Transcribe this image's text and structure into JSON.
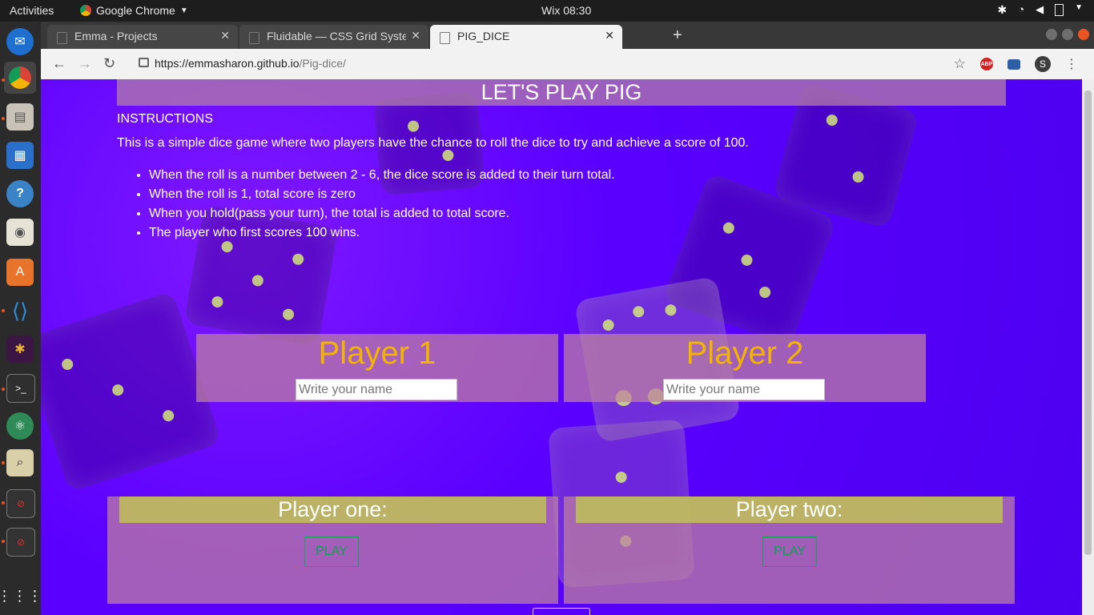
{
  "system": {
    "activities_label": "Activities",
    "app_name": "Google Chrome",
    "clock": "Wix 08:30"
  },
  "browser": {
    "tabs": [
      {
        "title": "Emma - Projects",
        "close": "✕"
      },
      {
        "title": "Fluidable — CSS Grid Syste",
        "close": "✕"
      },
      {
        "title": "PIG_DICE",
        "close": "✕"
      }
    ],
    "new_tab": "+",
    "url_host": "https://emmasharon.github.io",
    "url_path": "/Pig-dice/",
    "abp_label": "ABP",
    "profile_initial": "S"
  },
  "page": {
    "title": "LET'S PLAY PIG",
    "instructions_heading": "INSTRUCTIONS",
    "instructions_text": "This is a simple dice game where two players have the chance to roll the dice to try and achieve a score of 100.",
    "rules": [
      "When the roll is a number between 2 - 6, the dice score is added to their turn total.",
      "When the roll is 1, total score is zero",
      "When you hold(pass your turn), the total is added to total score.",
      "The player who first scores 100 wins."
    ],
    "players": [
      {
        "heading": "Player 1",
        "placeholder": "Write your name"
      },
      {
        "heading": "Player 2",
        "placeholder": "Write your name"
      }
    ],
    "boards": [
      {
        "title": "Player one:",
        "play_label": "PLAY"
      },
      {
        "title": "Player two:",
        "play_label": "PLAY"
      }
    ]
  },
  "colors": {
    "page_bg": "#5a00ff",
    "player_heading": "#f2b400",
    "play_button": "#10a050"
  }
}
